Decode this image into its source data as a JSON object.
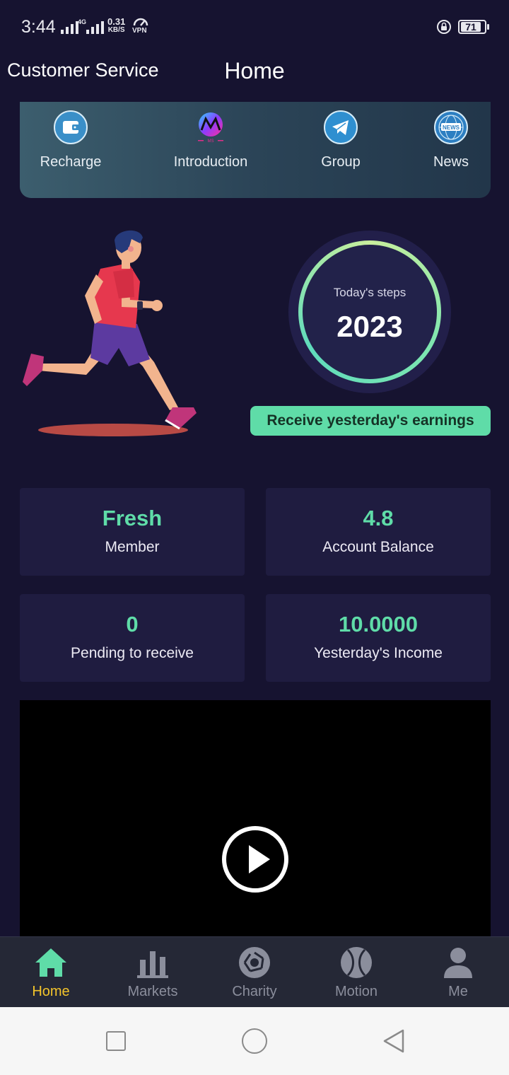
{
  "status_bar": {
    "time": "3:44",
    "network_speed": "0.31",
    "speed_unit": "KB/S",
    "vpn": "VPN",
    "battery": "71"
  },
  "header": {
    "left_link": "Customer Service",
    "title": "Home"
  },
  "quick_menu": [
    {
      "label": "Recharge",
      "icon": "wallet-icon"
    },
    {
      "label": "Introduction",
      "icon": "ms-logo-icon"
    },
    {
      "label": "Group",
      "icon": "telegram-icon"
    },
    {
      "label": "News",
      "icon": "news-globe-icon"
    }
  ],
  "steps": {
    "label": "Today's steps",
    "value": "2023"
  },
  "earnings_button": "Receive yesterday's earnings",
  "stats": [
    {
      "value": "Fresh",
      "label": "Member"
    },
    {
      "value": "4.8",
      "label": "Account Balance"
    },
    {
      "value": "0",
      "label": "Pending to receive"
    },
    {
      "value": "10.0000",
      "label": "Yesterday's Income"
    }
  ],
  "tabs": [
    {
      "label": "Home",
      "icon": "home-icon",
      "active": true
    },
    {
      "label": "Markets",
      "icon": "bar-chart-icon"
    },
    {
      "label": "Charity",
      "icon": "aperture-icon"
    },
    {
      "label": "Motion",
      "icon": "ball-icon"
    },
    {
      "label": "Me",
      "icon": "user-icon"
    }
  ],
  "colors": {
    "background": "#161330",
    "accent_green": "#5fdca8",
    "active_tab": "#f3c42b",
    "card": "#1f1c40"
  }
}
